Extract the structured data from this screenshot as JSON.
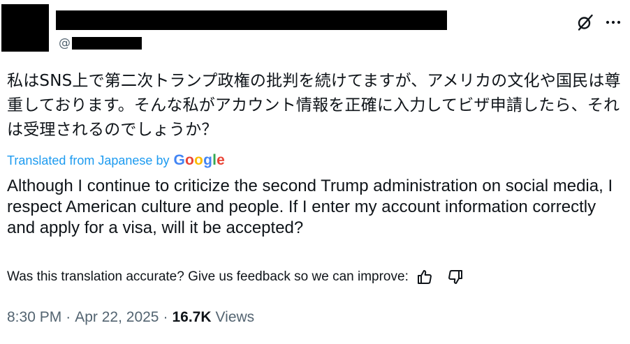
{
  "author": {
    "handle_prefix": "@"
  },
  "header_icons": {
    "grok": "grok-icon",
    "more": "more-icon"
  },
  "tweet": {
    "original_text": "私はSNS上で第二次トランプ政権の批判を続けてますが、アメリカの文化や国民は尊重しております。そんな私がアカウント情報を正確に入力してビザ申請したら、それは受理されるのでしょうか？",
    "translation_label": "Translated from Japanese by",
    "translation_provider": {
      "g1": "G",
      "g2": "o",
      "g3": "o",
      "g4": "g",
      "g5": "l",
      "g6": "e"
    },
    "translated_text": "Although I continue to criticize the second Trump administration on social media, I respect American culture and people. If I enter my account information correctly and apply for a visa, will it be accepted?"
  },
  "feedback": {
    "prompt": "Was this translation accurate? Give us feedback so we can improve:",
    "thumbs_up_icon": "thumbs-up-icon",
    "thumbs_down_icon": "thumbs-down-icon"
  },
  "meta": {
    "time": "8:30 PM",
    "separator": "·",
    "date": "Apr 22, 2025",
    "views_count": "16.7K",
    "views_label": "Views"
  },
  "colors": {
    "link_blue": "#1d9bf0",
    "text_primary": "#0f1419",
    "text_secondary": "#536471"
  }
}
